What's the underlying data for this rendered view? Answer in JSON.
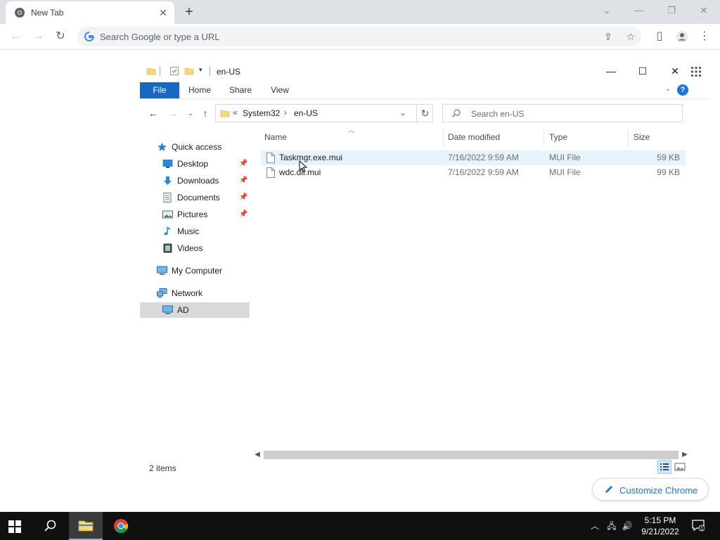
{
  "browser": {
    "tab_title": "New Tab",
    "omnibox_placeholder": "Search Google or type a URL"
  },
  "explorer": {
    "window_title": "en-US",
    "ribbon_tabs": [
      "File",
      "Home",
      "Share",
      "View"
    ],
    "breadcrumbs": [
      "System32",
      "en-US"
    ],
    "breadcrumb_overflow": "«",
    "search_placeholder": "Search en-US",
    "nav": {
      "quick_access": "Quick access",
      "desktop": "Desktop",
      "downloads": "Downloads",
      "documents": "Documents",
      "pictures": "Pictures",
      "music": "Music",
      "videos": "Videos",
      "my_computer": "My Computer",
      "network": "Network",
      "ad": "AD"
    },
    "columns": [
      "Name",
      "Date modified",
      "Type",
      "Size"
    ],
    "files": [
      {
        "name": "Taskmgr.exe.mui",
        "date": "7/16/2022 9:59 AM",
        "type": "MUI File",
        "size": "59 KB"
      },
      {
        "name": "wdc.dll.mui",
        "date": "7/16/2022 9:59 AM",
        "type": "MUI File",
        "size": "99 KB"
      }
    ],
    "status": "2 items"
  },
  "customize_chrome": "Customize Chrome",
  "taskbar": {
    "time": "5:15 PM",
    "date": "9/21/2022",
    "notification_count": "1"
  },
  "colors": {
    "accent": "#1967c4",
    "chrome_blue": "#1a73e8",
    "taskbar": "#101010",
    "folder_yellow": "#f8d775"
  }
}
